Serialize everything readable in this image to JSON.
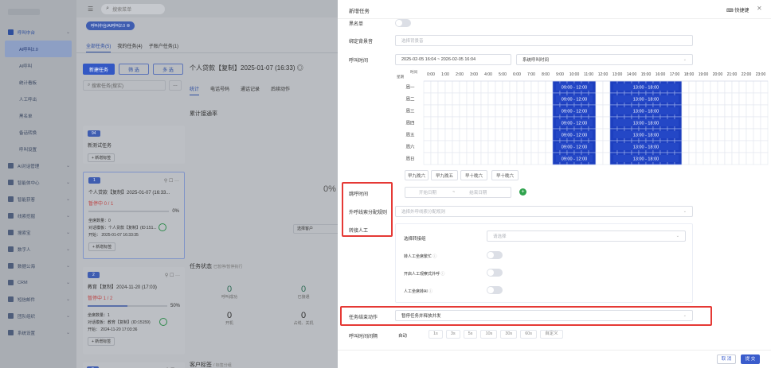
{
  "sidebar": {
    "items": [
      {
        "label": "呼叫中台",
        "icon": "phone-icon",
        "active": true
      },
      {
        "label": "AI呼叫2.0",
        "sub": true,
        "selected": true
      },
      {
        "label": "AI呼叫",
        "sub": true
      },
      {
        "label": "统计看板",
        "sub": true
      },
      {
        "label": "人工呼出",
        "sub": true
      },
      {
        "label": "黑名单",
        "sub": true
      },
      {
        "label": "备话转换",
        "sub": true
      },
      {
        "label": "呼叫设置",
        "sub": true
      },
      {
        "label": "AI对话管理",
        "icon": "chat-icon"
      },
      {
        "label": "智能体中心",
        "icon": "agent-icon"
      },
      {
        "label": "智能获客",
        "icon": "target-icon"
      },
      {
        "label": "线索挖掘",
        "icon": "mine-icon"
      },
      {
        "label": "搜索宝",
        "icon": "search-icon"
      },
      {
        "label": "数字人",
        "icon": "avatar-icon"
      },
      {
        "label": "数据公海",
        "icon": "database-icon"
      },
      {
        "label": "CRM",
        "icon": "crm-icon"
      },
      {
        "label": "短信邮件",
        "icon": "mail-icon"
      },
      {
        "label": "团队组织",
        "icon": "team-icon"
      },
      {
        "label": "系统设置",
        "icon": "settings-icon"
      }
    ]
  },
  "topbar": {
    "search_placeholder": "搜索菜单"
  },
  "background": {
    "breadcrumb": "呼叫中台/AI呼叫2.0",
    "tabs": [
      "全部任务(5)",
      "我的任务(4)",
      "子账户任务(1)"
    ],
    "new_task": "新建任务",
    "filter": "筛 选",
    "more": "多 选",
    "search_placeholder": "搜索任务(搜实)",
    "task_title": "个人贷款【复制】2025-01-07 (16:33) ◎",
    "inner_tabs": [
      "统计",
      "电话号码",
      "通话记录",
      "后续动作"
    ],
    "dial_rate_label": "累计接通率",
    "dial_rate_value": "0%",
    "status_label": "任务状态",
    "status_sub": "已暂停/暂停执行",
    "status_values": [
      {
        "v": "0",
        "l": "呼叫成功"
      },
      {
        "v": "0",
        "l": "已接通"
      },
      {
        "v": "0",
        "l": "开机"
      },
      {
        "v": "0",
        "l": "占线、关机"
      }
    ],
    "customer_label": "客户标签",
    "customer_sub": "标签分组",
    "select_customer": "选择客户",
    "cards": [
      {
        "badge": "94",
        "title": "新测试任务",
        "add": "+ 新增标签"
      },
      {
        "badge": "1",
        "title": "个人贷款【复制】2025-01-07 (16:33...",
        "status": "暂停中 0 / 1",
        "pct": "0%",
        "lines": [
          "坐席数量：0",
          "对话模板：个人贷款【复制】(ID:151...",
          "开始：   2025-01-07 16:33:35"
        ],
        "add": "+ 新增标签"
      },
      {
        "badge": "2",
        "title": "教育【复制】2024-11-20 (17:03)",
        "status": "暂停中 1 / 2",
        "pct": "50%",
        "lines": [
          "坐席数量：1",
          "对话模板：教育【复制】(ID:15159)",
          "开始：   2024-11-20 17:03:36"
        ],
        "add": "+ 新增标签"
      },
      {
        "badge": "3",
        "title": ""
      }
    ]
  },
  "drawer": {
    "title": "新增任务",
    "shortcut_label": "快捷键",
    "blacklist_label": "黑名单",
    "background_label": "绑定背景音",
    "background_placeholder": "选择背景音",
    "calltime_label": "呼叫时间",
    "date_range": "2025-02-05 16:04  ~  2026-02-05 16:04",
    "system_time": "系统呼叫时间",
    "schedule": {
      "corner_top": "时间",
      "corner_bottom": "星期",
      "hours": [
        "0:00",
        "1:00",
        "2:00",
        "3:00",
        "4:00",
        "5:00",
        "6:00",
        "7:00",
        "8:00",
        "9:00",
        "10:00",
        "11:00",
        "12:00",
        "13:00",
        "14:00",
        "15:00",
        "16:00",
        "17:00",
        "18:00",
        "19:00",
        "20:00",
        "21:00",
        "22:00",
        "23:00"
      ],
      "days": [
        "周一",
        "周二",
        "周三",
        "周四",
        "周五",
        "周六",
        "周日"
      ],
      "slots": [
        {
          "start": 9,
          "end": 12,
          "label": "09:00 - 12:00"
        },
        {
          "start": 13,
          "end": 18,
          "label": "13:00 - 18:00"
        }
      ],
      "color": "#1d3fbf"
    },
    "presets": [
      "早九晚六",
      "早九晚五",
      "早十晚六",
      "早十晚六"
    ],
    "skip_time_label": "跳呼时间",
    "start_date_ph": "开始日期",
    "end_date_ph": "结束日期",
    "outbound_rule_label": "外呼线索分配规则",
    "outbound_rule_ph": "选择外呼线索分配规则",
    "transfer_label": "转接人工",
    "transfer_group_label": "选择转接组",
    "transfer_group_ph": "请选择",
    "toggles": [
      "转人工坐席繁忙",
      "开启人工观察式外呼",
      "人工坐席转AI"
    ],
    "end_action_label": "任务结束动作",
    "end_action_value": "暂停任务并释放并发",
    "interval_label": "呼叫时间间隔",
    "interval_auto": "自动",
    "intervals": [
      "1s",
      "3s",
      "5s",
      "10s",
      "30s",
      "60s",
      "自定义"
    ],
    "cancel": "取 消",
    "submit": "提 交",
    "accent": "#3a5ccc",
    "highlight": "#e53935"
  }
}
